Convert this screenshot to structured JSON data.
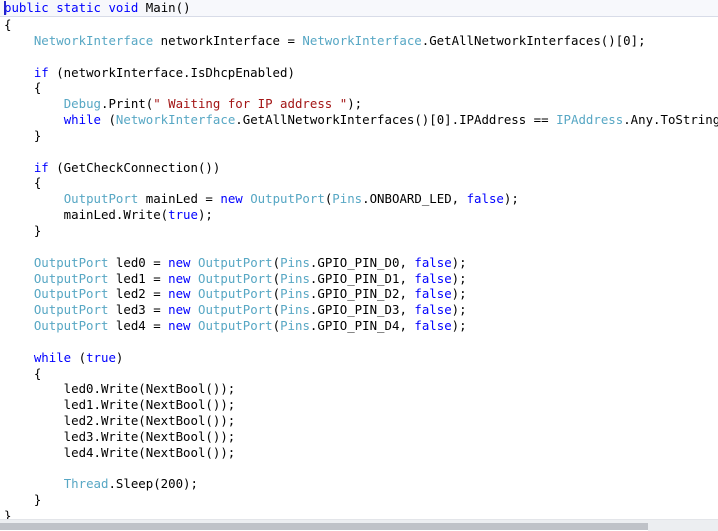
{
  "editor": {
    "language": "csharp",
    "background_color": "#ffffff",
    "current_line_background": "#f7f8fc",
    "colors": {
      "keyword": "#0000ff",
      "type": "#57a7c4",
      "string": "#a31515",
      "plain": "#000000",
      "caret": "#2222cc",
      "scrollbar_thumb": "#bfc2c8",
      "scrollbar_track": "#eceef1"
    },
    "caret_line": 1,
    "caret_column": 1
  },
  "scrollbar": {
    "orientation": "horizontal",
    "thumb_label": "horizontal-scroll-thumb",
    "track_label": "horizontal-scroll-track"
  },
  "code_lines": [
    {
      "id": 1,
      "tokens": [
        {
          "t": "public",
          "c": "kw"
        },
        {
          "t": " ",
          "c": "pln"
        },
        {
          "t": "static",
          "c": "kw"
        },
        {
          "t": " ",
          "c": "pln"
        },
        {
          "t": "void",
          "c": "kw"
        },
        {
          "t": " Main()",
          "c": "pln"
        }
      ]
    },
    {
      "id": 2,
      "tokens": [
        {
          "t": "{",
          "c": "pln"
        }
      ]
    },
    {
      "id": 3,
      "tokens": [
        {
          "t": "    ",
          "c": "pln"
        },
        {
          "t": "NetworkInterface",
          "c": "typ"
        },
        {
          "t": " networkInterface = ",
          "c": "pln"
        },
        {
          "t": "NetworkInterface",
          "c": "typ"
        },
        {
          "t": ".GetAllNetworkInterfaces()[0];",
          "c": "pln"
        }
      ]
    },
    {
      "id": 4,
      "tokens": [
        {
          "t": "",
          "c": "pln"
        }
      ]
    },
    {
      "id": 5,
      "tokens": [
        {
          "t": "    ",
          "c": "pln"
        },
        {
          "t": "if",
          "c": "kw"
        },
        {
          "t": " (networkInterface.IsDhcpEnabled)",
          "c": "pln"
        }
      ]
    },
    {
      "id": 6,
      "tokens": [
        {
          "t": "    {",
          "c": "pln"
        }
      ]
    },
    {
      "id": 7,
      "tokens": [
        {
          "t": "        ",
          "c": "pln"
        },
        {
          "t": "Debug",
          "c": "typ"
        },
        {
          "t": ".Print(",
          "c": "pln"
        },
        {
          "t": "\" Waiting for IP address \"",
          "c": "str"
        },
        {
          "t": ");",
          "c": "pln"
        }
      ]
    },
    {
      "id": 8,
      "tokens": [
        {
          "t": "        ",
          "c": "pln"
        },
        {
          "t": "while",
          "c": "kw"
        },
        {
          "t": " (",
          "c": "pln"
        },
        {
          "t": "NetworkInterface",
          "c": "typ"
        },
        {
          "t": ".GetAllNetworkInterfaces()[0].IPAddress == ",
          "c": "pln"
        },
        {
          "t": "IPAddress",
          "c": "typ"
        },
        {
          "t": ".Any.ToString());",
          "c": "pln"
        }
      ]
    },
    {
      "id": 9,
      "tokens": [
        {
          "t": "    }",
          "c": "pln"
        }
      ]
    },
    {
      "id": 10,
      "tokens": [
        {
          "t": "",
          "c": "pln"
        }
      ]
    },
    {
      "id": 11,
      "tokens": [
        {
          "t": "    ",
          "c": "pln"
        },
        {
          "t": "if",
          "c": "kw"
        },
        {
          "t": " (GetCheckConnection())",
          "c": "pln"
        }
      ]
    },
    {
      "id": 12,
      "tokens": [
        {
          "t": "    {",
          "c": "pln"
        }
      ]
    },
    {
      "id": 13,
      "tokens": [
        {
          "t": "        ",
          "c": "pln"
        },
        {
          "t": "OutputPort",
          "c": "typ"
        },
        {
          "t": " mainLed = ",
          "c": "pln"
        },
        {
          "t": "new",
          "c": "kw"
        },
        {
          "t": " ",
          "c": "pln"
        },
        {
          "t": "OutputPort",
          "c": "typ"
        },
        {
          "t": "(",
          "c": "pln"
        },
        {
          "t": "Pins",
          "c": "typ"
        },
        {
          "t": ".ONBOARD_LED, ",
          "c": "pln"
        },
        {
          "t": "false",
          "c": "kw"
        },
        {
          "t": ");",
          "c": "pln"
        }
      ]
    },
    {
      "id": 14,
      "tokens": [
        {
          "t": "        mainLed.Write(",
          "c": "pln"
        },
        {
          "t": "true",
          "c": "kw"
        },
        {
          "t": ");",
          "c": "pln"
        }
      ]
    },
    {
      "id": 15,
      "tokens": [
        {
          "t": "    }",
          "c": "pln"
        }
      ]
    },
    {
      "id": 16,
      "tokens": [
        {
          "t": "",
          "c": "pln"
        }
      ]
    },
    {
      "id": 17,
      "tokens": [
        {
          "t": "    ",
          "c": "pln"
        },
        {
          "t": "OutputPort",
          "c": "typ"
        },
        {
          "t": " led0 = ",
          "c": "pln"
        },
        {
          "t": "new",
          "c": "kw"
        },
        {
          "t": " ",
          "c": "pln"
        },
        {
          "t": "OutputPort",
          "c": "typ"
        },
        {
          "t": "(",
          "c": "pln"
        },
        {
          "t": "Pins",
          "c": "typ"
        },
        {
          "t": ".GPIO_PIN_D0, ",
          "c": "pln"
        },
        {
          "t": "false",
          "c": "kw"
        },
        {
          "t": ");",
          "c": "pln"
        }
      ]
    },
    {
      "id": 18,
      "tokens": [
        {
          "t": "    ",
          "c": "pln"
        },
        {
          "t": "OutputPort",
          "c": "typ"
        },
        {
          "t": " led1 = ",
          "c": "pln"
        },
        {
          "t": "new",
          "c": "kw"
        },
        {
          "t": " ",
          "c": "pln"
        },
        {
          "t": "OutputPort",
          "c": "typ"
        },
        {
          "t": "(",
          "c": "pln"
        },
        {
          "t": "Pins",
          "c": "typ"
        },
        {
          "t": ".GPIO_PIN_D1, ",
          "c": "pln"
        },
        {
          "t": "false",
          "c": "kw"
        },
        {
          "t": ");",
          "c": "pln"
        }
      ]
    },
    {
      "id": 19,
      "tokens": [
        {
          "t": "    ",
          "c": "pln"
        },
        {
          "t": "OutputPort",
          "c": "typ"
        },
        {
          "t": " led2 = ",
          "c": "pln"
        },
        {
          "t": "new",
          "c": "kw"
        },
        {
          "t": " ",
          "c": "pln"
        },
        {
          "t": "OutputPort",
          "c": "typ"
        },
        {
          "t": "(",
          "c": "pln"
        },
        {
          "t": "Pins",
          "c": "typ"
        },
        {
          "t": ".GPIO_PIN_D2, ",
          "c": "pln"
        },
        {
          "t": "false",
          "c": "kw"
        },
        {
          "t": ");",
          "c": "pln"
        }
      ]
    },
    {
      "id": 20,
      "tokens": [
        {
          "t": "    ",
          "c": "pln"
        },
        {
          "t": "OutputPort",
          "c": "typ"
        },
        {
          "t": " led3 = ",
          "c": "pln"
        },
        {
          "t": "new",
          "c": "kw"
        },
        {
          "t": " ",
          "c": "pln"
        },
        {
          "t": "OutputPort",
          "c": "typ"
        },
        {
          "t": "(",
          "c": "pln"
        },
        {
          "t": "Pins",
          "c": "typ"
        },
        {
          "t": ".GPIO_PIN_D3, ",
          "c": "pln"
        },
        {
          "t": "false",
          "c": "kw"
        },
        {
          "t": ");",
          "c": "pln"
        }
      ]
    },
    {
      "id": 21,
      "tokens": [
        {
          "t": "    ",
          "c": "pln"
        },
        {
          "t": "OutputPort",
          "c": "typ"
        },
        {
          "t": " led4 = ",
          "c": "pln"
        },
        {
          "t": "new",
          "c": "kw"
        },
        {
          "t": " ",
          "c": "pln"
        },
        {
          "t": "OutputPort",
          "c": "typ"
        },
        {
          "t": "(",
          "c": "pln"
        },
        {
          "t": "Pins",
          "c": "typ"
        },
        {
          "t": ".GPIO_PIN_D4, ",
          "c": "pln"
        },
        {
          "t": "false",
          "c": "kw"
        },
        {
          "t": ");",
          "c": "pln"
        }
      ]
    },
    {
      "id": 22,
      "tokens": [
        {
          "t": "",
          "c": "pln"
        }
      ]
    },
    {
      "id": 23,
      "tokens": [
        {
          "t": "    ",
          "c": "pln"
        },
        {
          "t": "while",
          "c": "kw"
        },
        {
          "t": " (",
          "c": "pln"
        },
        {
          "t": "true",
          "c": "kw"
        },
        {
          "t": ")",
          "c": "pln"
        }
      ]
    },
    {
      "id": 24,
      "tokens": [
        {
          "t": "    {",
          "c": "pln"
        }
      ]
    },
    {
      "id": 25,
      "tokens": [
        {
          "t": "        led0.Write(NextBool());",
          "c": "pln"
        }
      ]
    },
    {
      "id": 26,
      "tokens": [
        {
          "t": "        led1.Write(NextBool());",
          "c": "pln"
        }
      ]
    },
    {
      "id": 27,
      "tokens": [
        {
          "t": "        led2.Write(NextBool());",
          "c": "pln"
        }
      ]
    },
    {
      "id": 28,
      "tokens": [
        {
          "t": "        led3.Write(NextBool());",
          "c": "pln"
        }
      ]
    },
    {
      "id": 29,
      "tokens": [
        {
          "t": "        led4.Write(NextBool());",
          "c": "pln"
        }
      ]
    },
    {
      "id": 30,
      "tokens": [
        {
          "t": "",
          "c": "pln"
        }
      ]
    },
    {
      "id": 31,
      "tokens": [
        {
          "t": "        ",
          "c": "pln"
        },
        {
          "t": "Thread",
          "c": "typ"
        },
        {
          "t": ".Sleep(200);",
          "c": "pln"
        }
      ]
    },
    {
      "id": 32,
      "tokens": [
        {
          "t": "    }",
          "c": "pln"
        }
      ]
    },
    {
      "id": 33,
      "tokens": [
        {
          "t": "}",
          "c": "pln"
        }
      ]
    }
  ]
}
